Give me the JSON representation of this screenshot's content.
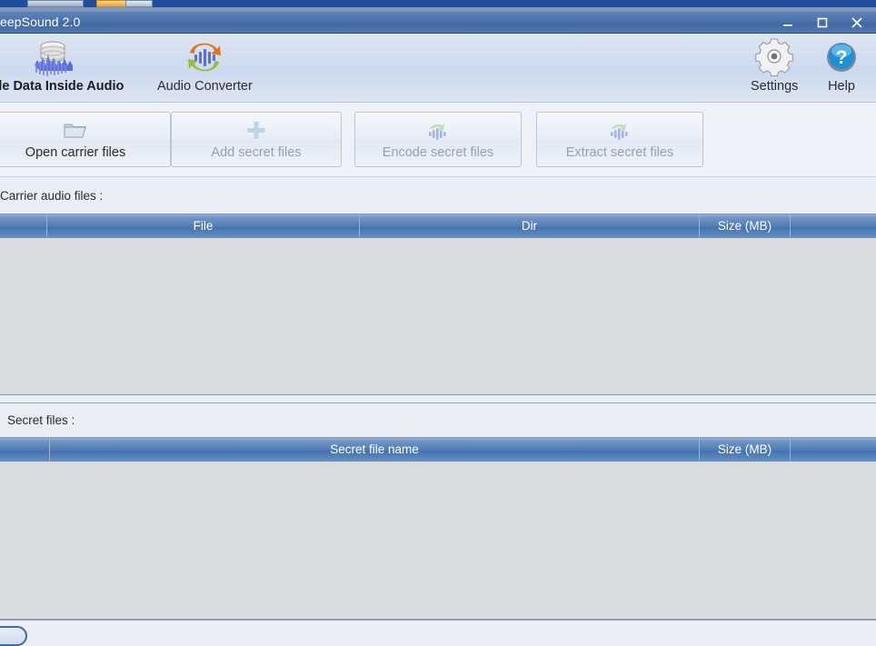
{
  "window": {
    "title": "eepSound 2.0",
    "controls": {
      "minimize": "minimize-icon",
      "maximize": "maximize-icon",
      "close": "close-icon"
    }
  },
  "toolbar": {
    "items": [
      {
        "label": "Hide Data Inside Audio",
        "icon": "database-waveform-icon",
        "active": true
      },
      {
        "label": "Audio Converter",
        "icon": "convert-arrows-waveform-icon",
        "active": false
      }
    ],
    "right_items": [
      {
        "label": "Settings",
        "icon": "gear-icon"
      },
      {
        "label": "Help",
        "icon": "help-question-icon"
      }
    ]
  },
  "actions": [
    {
      "label": "Open carrier files",
      "icon": "folder-open-icon",
      "enabled": true
    },
    {
      "label": "Add secret files",
      "icon": "plus-icon",
      "enabled": false
    },
    {
      "label": "Encode secret files",
      "icon": "waveform-icon",
      "enabled": false
    },
    {
      "label": "Extract secret files",
      "icon": "waveform-icon",
      "enabled": false
    }
  ],
  "carrier_section": {
    "label": "Carrier audio files :",
    "columns": [
      "",
      "File",
      "Dir",
      "Size (MB)",
      ""
    ],
    "rows": []
  },
  "secret_section": {
    "label": "Secret files :",
    "columns": [
      "",
      "Secret file name",
      "Size (MB)",
      ""
    ],
    "rows": []
  },
  "colors": {
    "titlebar": "#4b72ac",
    "header_blue": "#4e7ab3",
    "toolbar_bg": "#cfdbef",
    "list_bg": "#d8dcdf",
    "panel_bg": "#eaeef7",
    "accent_help": "#1f8fd6",
    "disabled_text": "#9aa0a8"
  }
}
